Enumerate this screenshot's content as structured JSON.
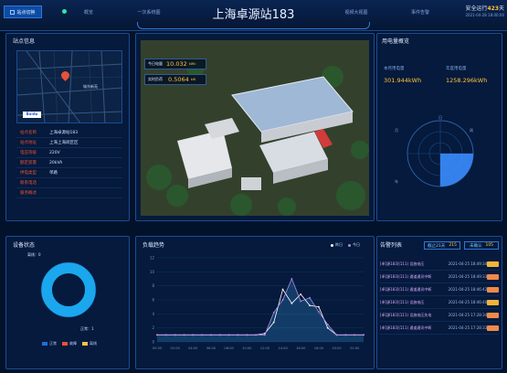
{
  "header": {
    "logo_label": "站点切换",
    "nav": [
      "概览",
      "一次系统图",
      "视频大视图",
      "事件告警"
    ],
    "title": "上海卓源站183",
    "safe_prefix": "安全运行",
    "safe_days": "423",
    "safe_suffix": "天",
    "timestamp": "2021-04-28 18:00:00"
  },
  "site_info": {
    "title": "站点信息",
    "map_label": "城东新苑",
    "rows": [
      {
        "k": "站点名称",
        "v": "上海卓源站183"
      },
      {
        "k": "站点地址",
        "v": "上海上海闵区区"
      },
      {
        "k": "电压等级",
        "v": "220V"
      },
      {
        "k": "额定容量",
        "v": "20kVA"
      },
      {
        "k": "供电类型",
        "v": "单路"
      },
      {
        "k": "联系电话",
        "v": ""
      },
      {
        "k": "服务概述",
        "v": ""
      }
    ]
  },
  "center": {
    "today_label": "今日电量",
    "today_value": "10.032",
    "today_unit": "kWh",
    "load_label": "实时负荷",
    "load_value": "0.5064",
    "load_unit": "kW"
  },
  "power_overview": {
    "title": "用电量概览",
    "month_label": "本月用电量",
    "month_value": "301.944kWh",
    "year_label": "年度用电量",
    "year_value": "1258.296kWh",
    "axis_labels": [
      "日",
      "周",
      "月",
      "年"
    ]
  },
  "device_status": {
    "title": "设备状态",
    "offline_label": "离线：0",
    "normal_label": "正常：1",
    "legend": [
      {
        "name": "正常",
        "color": "#1e6fd9"
      },
      {
        "name": "故障",
        "color": "#e8513a"
      },
      {
        "name": "离线",
        "color": "#f2c14e"
      }
    ]
  },
  "load_trend": {
    "title": "负载趋势",
    "legend": [
      "昨日",
      "今日"
    ]
  },
  "chart_data": {
    "type": "line",
    "title": "负载趋势",
    "x": [
      "00:00",
      "01:00",
      "02:00",
      "03:00",
      "04:00",
      "05:00",
      "06:00",
      "07:00",
      "08:00",
      "09:00",
      "10:00",
      "11:00",
      "12:00",
      "13:00",
      "14:00",
      "15:00",
      "16:00",
      "17:00",
      "18:00",
      "19:00",
      "20:00",
      "21:00",
      "22:00",
      "23:00"
    ],
    "ylim": [
      0,
      12
    ],
    "yticks": [
      0,
      2,
      4,
      6,
      8,
      10,
      12
    ],
    "series": [
      {
        "name": "昨日",
        "color": "#ffffff",
        "values": [
          1,
          1,
          1,
          1,
          1,
          1,
          1,
          1,
          1,
          1,
          1,
          1,
          1.2,
          2.8,
          7.5,
          5.5,
          6.8,
          5.2,
          5.0,
          2.0,
          1,
          1,
          1,
          1
        ]
      },
      {
        "name": "今日",
        "color": "#b58ae6",
        "values": [
          1,
          1,
          1,
          1,
          1,
          1,
          1,
          1,
          1,
          1,
          1,
          1,
          1,
          4.2,
          6.0,
          9.0,
          5.8,
          6.3,
          4.3,
          2.5,
          1,
          1,
          1,
          1
        ]
      }
    ]
  },
  "alarms": {
    "title": "告警列表",
    "tab1_label": "截止21天",
    "tab1_count": "215",
    "tab2_label": "未确认",
    "tab2_count": "105",
    "items": [
      {
        "text": "[卓]源183](111) 设施电压",
        "date": "2021-04-25 18:49:34",
        "color": "#f2b43a"
      },
      {
        "text": "[卓]源183](111) 通道通讯中断",
        "date": "2021-04-25 18:49:33",
        "color": "#f08a4b"
      },
      {
        "text": "[卓]源183](111) 通道通讯中断",
        "date": "2021-04-25 18:46:42",
        "color": "#f08a4b"
      },
      {
        "text": "[卓]源183](111) 设施电压",
        "date": "2021-04-25 18:46:40",
        "color": "#f2b43a"
      },
      {
        "text": "[卓]源183](111) 设施电压失电",
        "date": "2021-04-25 17:28:34",
        "color": "#f08a4b"
      },
      {
        "text": "[卓]源183](111) 通道通讯中断",
        "date": "2021-04-25 17:28:33",
        "color": "#f08a4b"
      }
    ]
  }
}
